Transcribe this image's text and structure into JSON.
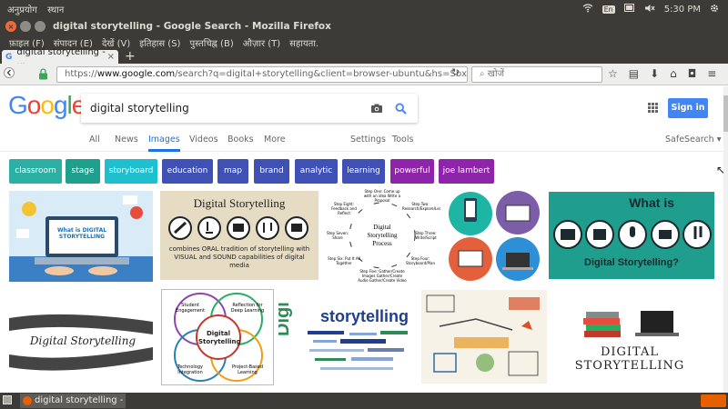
{
  "os_panel": {
    "menus": [
      "अनुप्रयोग",
      "स्थान"
    ],
    "keyboard": "En",
    "clock": "5:30 PM"
  },
  "window": {
    "title": "digital storytelling - Google Search - Mozilla Firefox",
    "menu": [
      "फ़ाइल (F)",
      "संपादन (E)",
      "देखें (V)",
      "इतिहास (S)",
      "पुस्तचिह्न (B)",
      "औज़ार (T)",
      "सहायता."
    ]
  },
  "tab": {
    "label": "digital storytelling - ...",
    "close": "×",
    "new": "+"
  },
  "nav": {
    "url_scheme": "https://",
    "url_host": "www.google.com",
    "url_rest": "/search?q=digital+storytelling&client=browser-ubuntu&hs=Sbx&channel=fe",
    "search_placeholder": "खोजें"
  },
  "google": {
    "logo": [
      "G",
      "o",
      "o",
      "g",
      "l",
      "e"
    ],
    "query": "digital storytelling",
    "sign_in": "Sign in",
    "tabs": [
      "All",
      "News",
      "Images",
      "Videos",
      "Books",
      "More"
    ],
    "active_tab": "Images",
    "tools": [
      "Settings",
      "Tools"
    ],
    "safesearch": "SafeSearch ▾"
  },
  "chips": [
    {
      "label": "classroom",
      "color": "#2bb0a3"
    },
    {
      "label": "stage",
      "color": "#1f9f8e"
    },
    {
      "label": "storyboard",
      "color": "#1ec0d0"
    },
    {
      "label": "education",
      "color": "#3f51b5"
    },
    {
      "label": "map",
      "color": "#3f51b5"
    },
    {
      "label": "brand",
      "color": "#3f51b5"
    },
    {
      "label": "analytic",
      "color": "#3f51b5"
    },
    {
      "label": "learning",
      "color": "#3f51b5"
    },
    {
      "label": "powerful",
      "color": "#8e24aa"
    },
    {
      "label": "joe lambert",
      "color": "#8e24aa"
    }
  ],
  "images": {
    "img1": {
      "caption": "What is DIGITAL STORYTELLING"
    },
    "img2": {
      "title": "Digital Storytelling",
      "sub": "combines ORAL tradition of storytelling with VISUAL and SOUND capabilities of digital media"
    },
    "img3": {
      "center": "Digital Storytelling Process",
      "steps": [
        "Step One: Come up with an idea Write a Proposal",
        "Step Two: Research/Explore/Learn",
        "Step Three: Write/Script",
        "Step Four: Storyboard/Plan",
        "Step Five: Gather/Create Images Gather/Create Audio Gather/Create Video",
        "Step Six: Put It All Together",
        "Step Seven: Share",
        "Step Eight: Feedback and Reflect"
      ]
    },
    "img5": {
      "title": "What is",
      "sub": "Digital Storytelling?"
    },
    "img6": {
      "title": "Digital Storytelling"
    },
    "img7": {
      "center": "Digital Storytelling",
      "bubbles": [
        "Student Engagement",
        "Reflection for Deep Learning",
        "Technology Integration",
        "Project-Based Learning"
      ]
    },
    "img8": {
      "word_big": "storytelling",
      "word_vert": "Digital"
    },
    "img10": {
      "title": "DIGITAL STORYTELLING"
    }
  },
  "taskbar": {
    "task": "digital storytelling - ..."
  }
}
